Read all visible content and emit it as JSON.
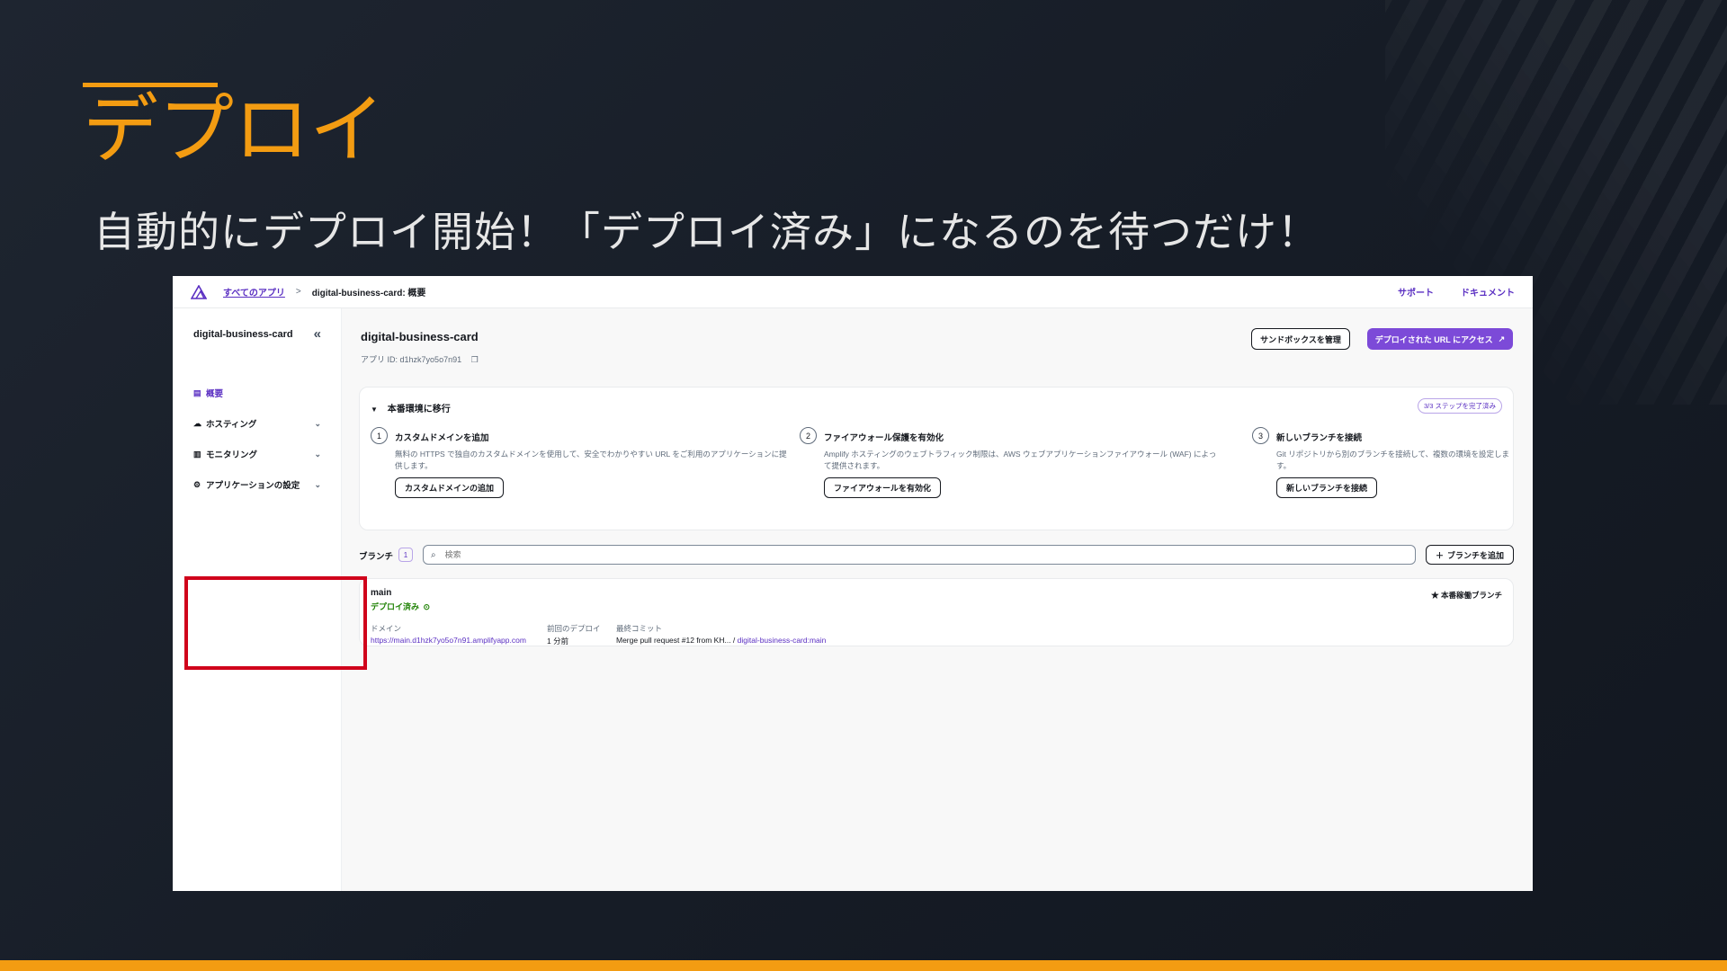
{
  "slide": {
    "title": "デプロイ",
    "subtitle": "自動的にデプロイ開始！「デプロイ済み」になるのを待つだけ！",
    "colors": {
      "accent": "#f39c12",
      "highlight": "#d0021b",
      "brand": "#7c4ad8"
    }
  },
  "topnav": {
    "breadcrumb_link": "すべてのアプリ",
    "breadcrumb_separator": ">",
    "breadcrumb_current": "digital-business-card: 概要",
    "support": "サポート",
    "docs": "ドキュメント"
  },
  "sidebar": {
    "app_name": "digital-business-card",
    "collapse_glyph": "«",
    "items": [
      {
        "label": "概要",
        "icon": "document-icon"
      },
      {
        "label": "ホスティング",
        "icon": "cloud-icon"
      },
      {
        "label": "モニタリング",
        "icon": "chart-icon"
      },
      {
        "label": "アプリケーションの設定",
        "icon": "gear-icon"
      }
    ]
  },
  "header": {
    "app_title": "digital-business-card",
    "app_id_label": "アプリ ID:",
    "app_id_value": "d1hzk7yo5o7n91",
    "sandbox_button": "サンドボックスを管理",
    "deploy_url_button": "デプロイされた URL にアクセス"
  },
  "production": {
    "heading": "本番環境に移行",
    "skip_label": "3/3 ステップを完了済み",
    "steps": [
      {
        "num": "1",
        "title": "カスタムドメインを追加",
        "desc": "無料の HTTPS で独自のカスタムドメインを使用して、安全でわかりやすい URL をご利用のアプリケーションに提供します。",
        "button": "カスタムドメインの追加"
      },
      {
        "num": "2",
        "title": "ファイアウォール保護を有効化",
        "desc": "Amplify ホスティングのウェブトラフィック制限は、AWS ウェブアプリケーションファイアウォール (WAF) によって提供されます。",
        "button": "ファイアウォールを有効化"
      },
      {
        "num": "3",
        "title": "新しいブランチを接続",
        "desc": "Git リポジトリから別のブランチを接続して、複数の環境を設定します。",
        "button": "新しいブランチを接続"
      }
    ]
  },
  "branches": {
    "label": "ブランチ",
    "count": "1",
    "search_placeholder": "検索",
    "add_button": "ブランチを追加",
    "card": {
      "name": "main",
      "status": "デプロイ済み",
      "production_label": "本番稼働ブランチ",
      "domain_label": "ドメイン",
      "domain_value": "https://main.d1hzk7yo5o7n91.amplifyapp.com",
      "last_deploy_label": "前回のデプロイ",
      "last_deploy_value": "1 分前",
      "last_commit_label": "最終コミット",
      "last_commit_value": "Merge pull request #12 from KH...",
      "last_commit_ref": "digital-business-card:main"
    }
  }
}
